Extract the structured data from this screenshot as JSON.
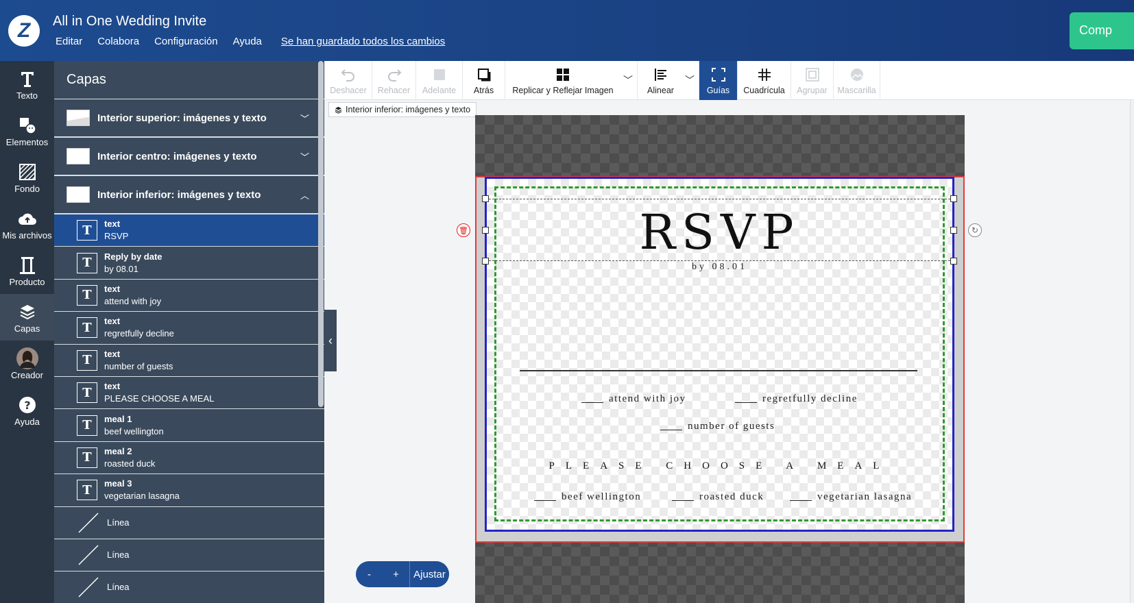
{
  "header": {
    "logo_letter": "Z",
    "title": "All in One Wedding Invite",
    "menu": [
      "Editar",
      "Colabora",
      "Configuración",
      "Ayuda"
    ],
    "saved_status": "Se han guardado todos los cambios",
    "buy_label": "Comp",
    "bg_color": "#1d4b8f",
    "buy_color": "#2ec58d"
  },
  "rail": {
    "items": [
      {
        "label": "Texto",
        "icon": "text-icon"
      },
      {
        "label": "Elementos",
        "icon": "shapes-icon"
      },
      {
        "label": "Fondo",
        "icon": "background-icon"
      },
      {
        "label": "Mis archivos",
        "icon": "cloud-upload-icon"
      },
      {
        "label": "Producto",
        "icon": "product-icon"
      },
      {
        "label": "Capas",
        "icon": "layers-icon"
      },
      {
        "label": "Creador",
        "icon": "avatar"
      },
      {
        "label": "Ayuda",
        "icon": "help-icon"
      }
    ]
  },
  "layers": {
    "title": "Capas",
    "groups": [
      {
        "label": "Interior superior: imágenes y texto",
        "expanded": false
      },
      {
        "label": "Interior centro: imágenes y texto",
        "expanded": false
      },
      {
        "label": "Interior inferior: imágenes y texto",
        "expanded": true
      }
    ],
    "items": [
      {
        "name": "text",
        "content": "RSVP",
        "type": "text",
        "selected": true
      },
      {
        "name": "Reply by date",
        "content": "by 08.01",
        "type": "text"
      },
      {
        "name": "text",
        "content": "attend with joy",
        "type": "text"
      },
      {
        "name": "text",
        "content": "regretfully decline",
        "type": "text"
      },
      {
        "name": "text",
        "content": "number of guests",
        "type": "text"
      },
      {
        "name": "text",
        "content": "PLEASE CHOOSE A MEAL",
        "type": "text"
      },
      {
        "name": "meal 1",
        "content": "beef wellington",
        "type": "text"
      },
      {
        "name": "meal 2",
        "content": "roasted duck",
        "type": "text"
      },
      {
        "name": "meal 3",
        "content": "vegetarian lasagna",
        "type": "text"
      },
      {
        "name": "Línea",
        "type": "line"
      },
      {
        "name": "Línea",
        "type": "line"
      },
      {
        "name": "Línea",
        "type": "line"
      }
    ]
  },
  "toolbar": {
    "buttons": [
      {
        "label": "Deshacer",
        "icon": "undo-icon",
        "disabled": true
      },
      {
        "label": "Rehacer",
        "icon": "redo-icon",
        "disabled": true
      },
      {
        "label": "Adelante",
        "icon": "bring-forward-icon",
        "disabled": true
      },
      {
        "label": "Atrás",
        "icon": "send-backward-icon",
        "disabled": false
      },
      {
        "label": "Replicar y Reflejar Imagen",
        "icon": "replicate-icon",
        "disabled": false
      },
      {
        "label": "Alinear",
        "icon": "align-icon",
        "disabled": false
      },
      {
        "label": "Guías",
        "icon": "guides-icon",
        "active": true
      },
      {
        "label": "Cuadrícula",
        "icon": "grid-icon",
        "disabled": false
      },
      {
        "label": "Agrupar",
        "icon": "group-icon",
        "disabled": true
      },
      {
        "label": "Mascarilla",
        "icon": "mask-icon",
        "disabled": true
      }
    ],
    "active_color": "#1f4e95"
  },
  "breadcrumb": "Interior inferior: imágenes y texto",
  "card": {
    "title": "RSVP",
    "byline": "by 08.01",
    "attend": "attend with joy",
    "decline": "regretfully decline",
    "guests": "number of guests",
    "meal_heading": "PLEASE CHOOSE A MEAL",
    "meals": [
      "beef wellington",
      "roasted duck",
      "vegetarian lasagna"
    ]
  },
  "zoom": {
    "minus": "-",
    "plus": "+",
    "fit": "Ajustar"
  }
}
